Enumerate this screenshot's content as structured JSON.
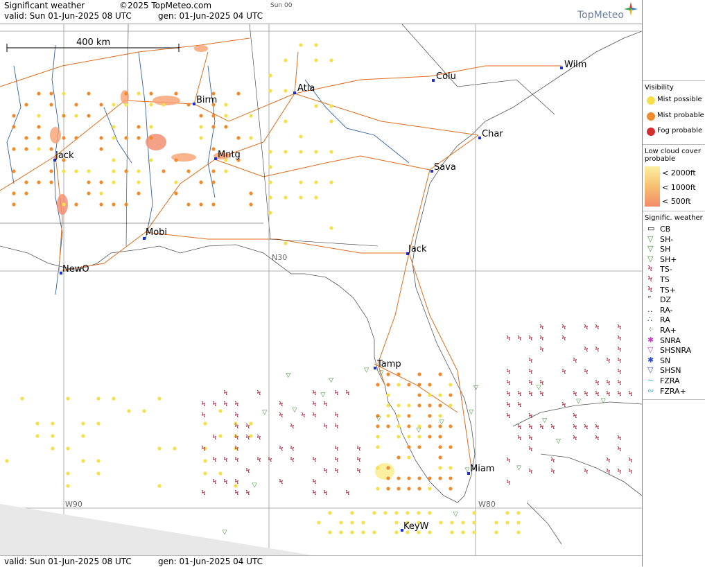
{
  "header": {
    "title": "Significant weather",
    "copyright": "©2025 TopMeteo.com",
    "sun_tag": "Sun 00",
    "valid": "valid:  Sun  01-Jun-2025  08 UTC",
    "gen": "gen: 01-Jun-2025 04 UTC",
    "logo": "TopMeteo"
  },
  "footer": {
    "valid": "valid:  Sun  01-Jun-2025  08 UTC",
    "gen": "gen: 01-Jun-2025 04 UTC"
  },
  "map": {
    "scale_label": "400 km",
    "grid_labels": [
      "N30",
      "W90",
      "W80"
    ],
    "cities": [
      {
        "name": "Atla"
      },
      {
        "name": "Colu"
      },
      {
        "name": "Wilm"
      },
      {
        "name": "Birm"
      },
      {
        "name": "Char"
      },
      {
        "name": "Jack"
      },
      {
        "name": "Mntg"
      },
      {
        "name": "Sava"
      },
      {
        "name": "Mobi"
      },
      {
        "name": "Jack"
      },
      {
        "name": "NewO"
      },
      {
        "name": "Tamp"
      },
      {
        "name": "Miam"
      },
      {
        "name": "KeyW"
      }
    ]
  },
  "legend": {
    "visibility_title": "Visibility",
    "visibility_items": [
      {
        "label": "Mist possible",
        "color": "#f5e04a"
      },
      {
        "label": "Mist probable",
        "color": "#f08a2a"
      },
      {
        "label": "Fog probable",
        "color": "#d42f2f"
      }
    ],
    "cloud_title": "Low cloud cover probable",
    "cloud_items": [
      {
        "label": "< 2000ft",
        "color": "#fbf0a0"
      },
      {
        "label": "< 1000ft",
        "color": "#f8c070"
      },
      {
        "label": "<   500ft",
        "color": "#f28a6a"
      }
    ],
    "sigwx_title": "Signific. weather",
    "sigwx_items": [
      {
        "label": "CB",
        "icon": "cb-icon"
      },
      {
        "label": "SH-",
        "icon": "shower-light-icon"
      },
      {
        "label": "SH",
        "icon": "shower-icon"
      },
      {
        "label": "SH+",
        "icon": "shower-heavy-icon"
      },
      {
        "label": "TS-",
        "icon": "thunderstorm-light-icon"
      },
      {
        "label": "TS",
        "icon": "thunderstorm-icon"
      },
      {
        "label": "TS+",
        "icon": "thunderstorm-heavy-icon"
      },
      {
        "label": "DZ",
        "icon": "drizzle-icon"
      },
      {
        "label": "RA-",
        "icon": "rain-light-icon"
      },
      {
        "label": "RA",
        "icon": "rain-icon"
      },
      {
        "label": "RA+",
        "icon": "rain-heavy-icon"
      },
      {
        "label": "SNRA",
        "icon": "snow-rain-icon"
      },
      {
        "label": "SHSNRA",
        "icon": "snow-rain-shower-icon"
      },
      {
        "label": "SN",
        "icon": "snow-icon"
      },
      {
        "label": "SHSN",
        "icon": "snow-shower-icon"
      },
      {
        "label": "FZRA",
        "icon": "freezing-rain-icon"
      },
      {
        "label": "FZRA+",
        "icon": "freezing-rain-heavy-icon"
      }
    ]
  }
}
